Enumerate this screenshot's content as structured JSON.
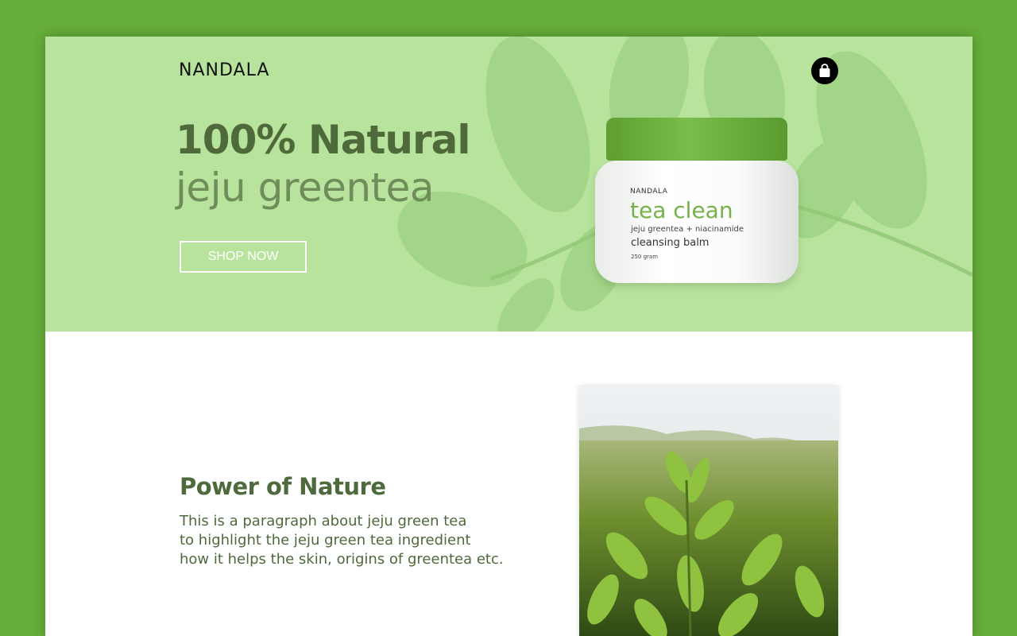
{
  "brand": {
    "logo_text": "NANDALA"
  },
  "header": {
    "cart_icon": "shopping-bag-icon"
  },
  "hero": {
    "headline": "100% Natural",
    "subheadline": "jeju greentea",
    "cta_label": "SHOP NOW",
    "background_color": "#b8e39d"
  },
  "product": {
    "brand": "NANDALA",
    "name": "tea clean",
    "ingredients": "jeju greentea + niacinamide",
    "type": "cleansing balm",
    "weight": "250 gram",
    "lid_color": "#6aad3d"
  },
  "feature": {
    "title": "Power of Nature",
    "paragraph_lines": [
      "This is a paragraph about jeju green tea",
      "to highlight the jeju green tea ingredient",
      "how it helps the skin, origins of greentea etc."
    ],
    "image": "tea-plantation-photo"
  },
  "colors": {
    "outer_background": "#66ad3a",
    "text_green": "#4e6a3c",
    "accent_green": "#77b14b"
  }
}
